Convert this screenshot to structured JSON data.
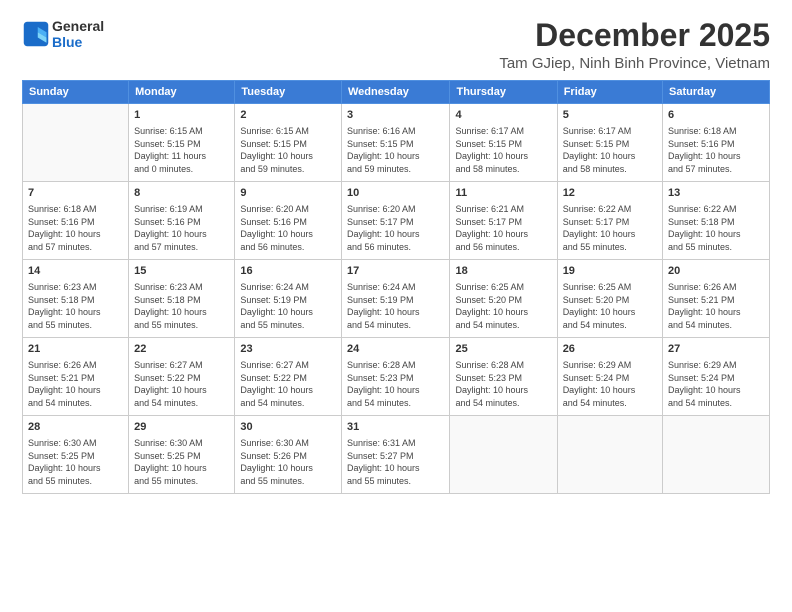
{
  "header": {
    "logo_general": "General",
    "logo_blue": "Blue",
    "title": "December 2025",
    "subtitle": "Tam GJiep, Ninh Binh Province, Vietnam"
  },
  "days_of_week": [
    "Sunday",
    "Monday",
    "Tuesday",
    "Wednesday",
    "Thursday",
    "Friday",
    "Saturday"
  ],
  "weeks": [
    [
      {
        "day": "",
        "info": ""
      },
      {
        "day": "1",
        "info": "Sunrise: 6:15 AM\nSunset: 5:15 PM\nDaylight: 11 hours\nand 0 minutes."
      },
      {
        "day": "2",
        "info": "Sunrise: 6:15 AM\nSunset: 5:15 PM\nDaylight: 10 hours\nand 59 minutes."
      },
      {
        "day": "3",
        "info": "Sunrise: 6:16 AM\nSunset: 5:15 PM\nDaylight: 10 hours\nand 59 minutes."
      },
      {
        "day": "4",
        "info": "Sunrise: 6:17 AM\nSunset: 5:15 PM\nDaylight: 10 hours\nand 58 minutes."
      },
      {
        "day": "5",
        "info": "Sunrise: 6:17 AM\nSunset: 5:15 PM\nDaylight: 10 hours\nand 58 minutes."
      },
      {
        "day": "6",
        "info": "Sunrise: 6:18 AM\nSunset: 5:16 PM\nDaylight: 10 hours\nand 57 minutes."
      }
    ],
    [
      {
        "day": "7",
        "info": "Sunrise: 6:18 AM\nSunset: 5:16 PM\nDaylight: 10 hours\nand 57 minutes."
      },
      {
        "day": "8",
        "info": "Sunrise: 6:19 AM\nSunset: 5:16 PM\nDaylight: 10 hours\nand 57 minutes."
      },
      {
        "day": "9",
        "info": "Sunrise: 6:20 AM\nSunset: 5:16 PM\nDaylight: 10 hours\nand 56 minutes."
      },
      {
        "day": "10",
        "info": "Sunrise: 6:20 AM\nSunset: 5:17 PM\nDaylight: 10 hours\nand 56 minutes."
      },
      {
        "day": "11",
        "info": "Sunrise: 6:21 AM\nSunset: 5:17 PM\nDaylight: 10 hours\nand 56 minutes."
      },
      {
        "day": "12",
        "info": "Sunrise: 6:22 AM\nSunset: 5:17 PM\nDaylight: 10 hours\nand 55 minutes."
      },
      {
        "day": "13",
        "info": "Sunrise: 6:22 AM\nSunset: 5:18 PM\nDaylight: 10 hours\nand 55 minutes."
      }
    ],
    [
      {
        "day": "14",
        "info": "Sunrise: 6:23 AM\nSunset: 5:18 PM\nDaylight: 10 hours\nand 55 minutes."
      },
      {
        "day": "15",
        "info": "Sunrise: 6:23 AM\nSunset: 5:18 PM\nDaylight: 10 hours\nand 55 minutes."
      },
      {
        "day": "16",
        "info": "Sunrise: 6:24 AM\nSunset: 5:19 PM\nDaylight: 10 hours\nand 55 minutes."
      },
      {
        "day": "17",
        "info": "Sunrise: 6:24 AM\nSunset: 5:19 PM\nDaylight: 10 hours\nand 54 minutes."
      },
      {
        "day": "18",
        "info": "Sunrise: 6:25 AM\nSunset: 5:20 PM\nDaylight: 10 hours\nand 54 minutes."
      },
      {
        "day": "19",
        "info": "Sunrise: 6:25 AM\nSunset: 5:20 PM\nDaylight: 10 hours\nand 54 minutes."
      },
      {
        "day": "20",
        "info": "Sunrise: 6:26 AM\nSunset: 5:21 PM\nDaylight: 10 hours\nand 54 minutes."
      }
    ],
    [
      {
        "day": "21",
        "info": "Sunrise: 6:26 AM\nSunset: 5:21 PM\nDaylight: 10 hours\nand 54 minutes."
      },
      {
        "day": "22",
        "info": "Sunrise: 6:27 AM\nSunset: 5:22 PM\nDaylight: 10 hours\nand 54 minutes."
      },
      {
        "day": "23",
        "info": "Sunrise: 6:27 AM\nSunset: 5:22 PM\nDaylight: 10 hours\nand 54 minutes."
      },
      {
        "day": "24",
        "info": "Sunrise: 6:28 AM\nSunset: 5:23 PM\nDaylight: 10 hours\nand 54 minutes."
      },
      {
        "day": "25",
        "info": "Sunrise: 6:28 AM\nSunset: 5:23 PM\nDaylight: 10 hours\nand 54 minutes."
      },
      {
        "day": "26",
        "info": "Sunrise: 6:29 AM\nSunset: 5:24 PM\nDaylight: 10 hours\nand 54 minutes."
      },
      {
        "day": "27",
        "info": "Sunrise: 6:29 AM\nSunset: 5:24 PM\nDaylight: 10 hours\nand 54 minutes."
      }
    ],
    [
      {
        "day": "28",
        "info": "Sunrise: 6:30 AM\nSunset: 5:25 PM\nDaylight: 10 hours\nand 55 minutes."
      },
      {
        "day": "29",
        "info": "Sunrise: 6:30 AM\nSunset: 5:25 PM\nDaylight: 10 hours\nand 55 minutes."
      },
      {
        "day": "30",
        "info": "Sunrise: 6:30 AM\nSunset: 5:26 PM\nDaylight: 10 hours\nand 55 minutes."
      },
      {
        "day": "31",
        "info": "Sunrise: 6:31 AM\nSunset: 5:27 PM\nDaylight: 10 hours\nand 55 minutes."
      },
      {
        "day": "",
        "info": ""
      },
      {
        "day": "",
        "info": ""
      },
      {
        "day": "",
        "info": ""
      }
    ]
  ]
}
